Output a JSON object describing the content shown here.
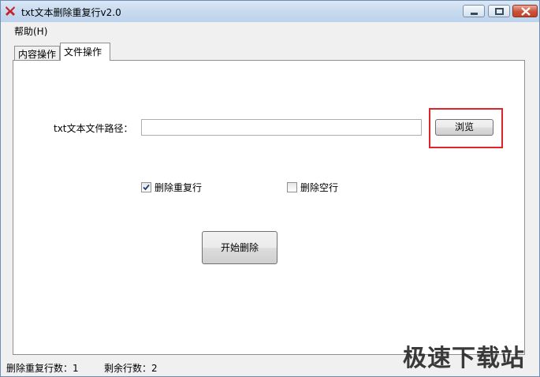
{
  "window": {
    "title": "txt文本删除重复行v2.0"
  },
  "menu": {
    "help": "帮助(H)"
  },
  "tabs": [
    {
      "label": "内容操作",
      "active": false
    },
    {
      "label": "文件操作",
      "active": true
    }
  ],
  "form": {
    "path_label": "txt文本文件路径：",
    "path_value": "",
    "browse_label": "浏览",
    "delete_duplicates_label": "删除重复行",
    "delete_duplicates_checked": true,
    "delete_empty_label": "删除空行",
    "delete_empty_checked": false,
    "start_label": "开始删除"
  },
  "status": {
    "duplicates_removed": "删除重复行数：1",
    "remaining_lines": "剩余行数：2"
  },
  "watermark": "极速下载站",
  "colors": {
    "highlight": "#e0242c",
    "titlebar": "#c7daef"
  }
}
